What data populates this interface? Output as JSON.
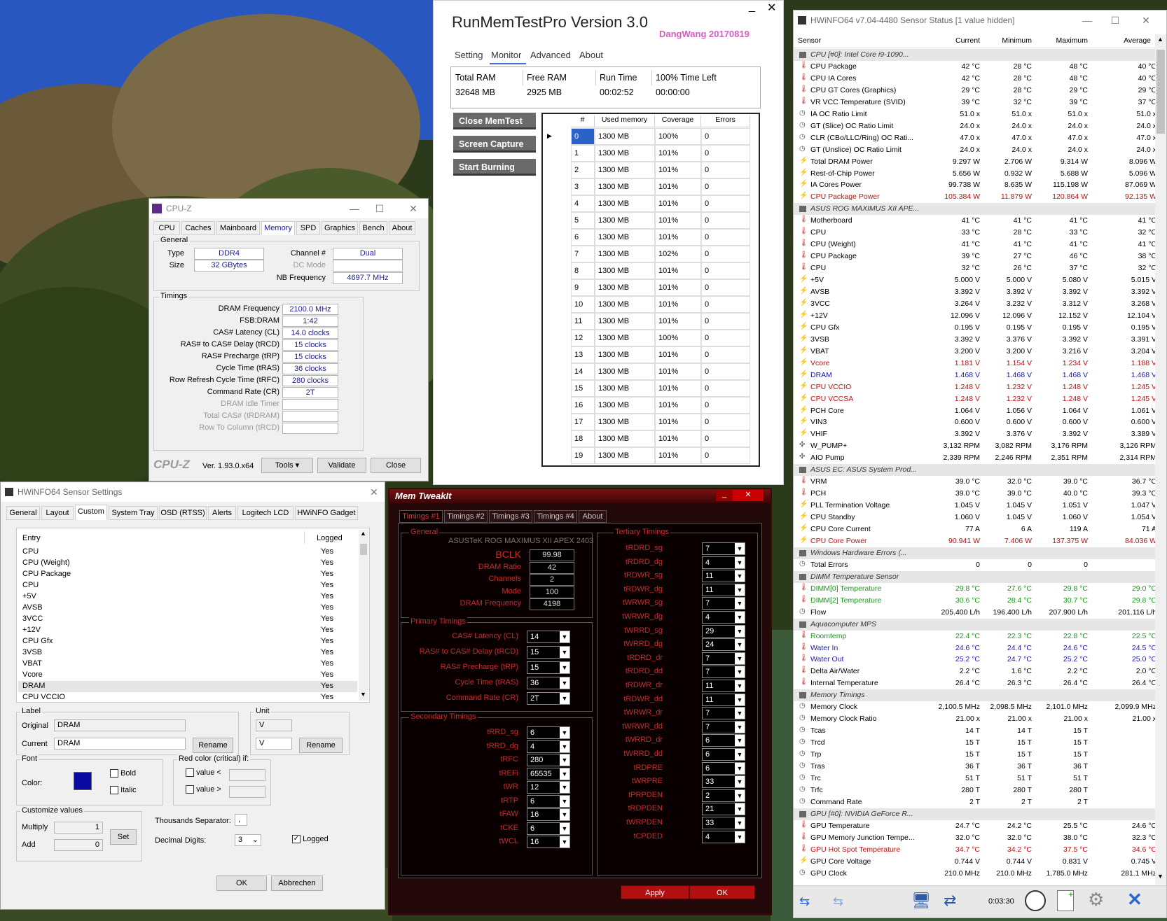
{
  "runmem": {
    "title": "RunMemTestPro Version 3.0",
    "author": "DangWang 20170819",
    "tabs": [
      "Setting",
      "Monitor",
      "Advanced",
      "About"
    ],
    "stats": [
      {
        "label": "Total RAM",
        "value": "32648 MB"
      },
      {
        "label": "Free RAM",
        "value": "2925 MB"
      },
      {
        "label": "Run Time",
        "value": "00:02:52"
      },
      {
        "label": "100% Time Left",
        "value": "00:00:00"
      }
    ],
    "buttons": [
      "Close MemTest",
      "Screen Capture",
      "Start Burning"
    ],
    "headers": [
      "#",
      "Used memory",
      "Coverage",
      "Errors"
    ],
    "rows": [
      [
        "0",
        "1300 MB",
        "100%",
        "0"
      ],
      [
        "1",
        "1300 MB",
        "101%",
        "0"
      ],
      [
        "2",
        "1300 MB",
        "101%",
        "0"
      ],
      [
        "3",
        "1300 MB",
        "101%",
        "0"
      ],
      [
        "4",
        "1300 MB",
        "101%",
        "0"
      ],
      [
        "5",
        "1300 MB",
        "101%",
        "0"
      ],
      [
        "6",
        "1300 MB",
        "101%",
        "0"
      ],
      [
        "7",
        "1300 MB",
        "102%",
        "0"
      ],
      [
        "8",
        "1300 MB",
        "101%",
        "0"
      ],
      [
        "9",
        "1300 MB",
        "101%",
        "0"
      ],
      [
        "10",
        "1300 MB",
        "101%",
        "0"
      ],
      [
        "11",
        "1300 MB",
        "101%",
        "0"
      ],
      [
        "12",
        "1300 MB",
        "100%",
        "0"
      ],
      [
        "13",
        "1300 MB",
        "101%",
        "0"
      ],
      [
        "14",
        "1300 MB",
        "101%",
        "0"
      ],
      [
        "15",
        "1300 MB",
        "101%",
        "0"
      ],
      [
        "16",
        "1300 MB",
        "101%",
        "0"
      ],
      [
        "17",
        "1300 MB",
        "101%",
        "0"
      ],
      [
        "18",
        "1300 MB",
        "101%",
        "0"
      ],
      [
        "19",
        "1300 MB",
        "101%",
        "0"
      ]
    ]
  },
  "cpuz": {
    "title": "CPU-Z",
    "tabs": [
      "CPU",
      "Caches",
      "Mainboard",
      "Memory",
      "SPD",
      "Graphics",
      "Bench",
      "About"
    ],
    "active_tab": "Memory",
    "general_label": "General",
    "type_label": "Type",
    "type": "DDR4",
    "size_label": "Size",
    "size": "32 GBytes",
    "channel_label": "Channel #",
    "channel": "Dual",
    "dcmode_label": "DC Mode",
    "nbfreq_label": "NB Frequency",
    "nbfreq": "4697.7 MHz",
    "timings_label": "Timings",
    "timings": [
      [
        "DRAM Frequency",
        "2100.0 MHz"
      ],
      [
        "FSB:DRAM",
        "1:42"
      ],
      [
        "CAS# Latency (CL)",
        "14.0 clocks"
      ],
      [
        "RAS# to CAS# Delay (tRCD)",
        "15 clocks"
      ],
      [
        "RAS# Precharge (tRP)",
        "15 clocks"
      ],
      [
        "Cycle Time (tRAS)",
        "36 clocks"
      ],
      [
        "Row Refresh Cycle Time (tRFC)",
        "280 clocks"
      ],
      [
        "Command Rate (CR)",
        "2T"
      ]
    ],
    "timings_grey": [
      "DRAM Idle Timer",
      "Total CAS# (tRDRAM)",
      "Row To Column (tRCD)"
    ],
    "brand": "CPU-Z",
    "version": "Ver. 1.93.0.x64",
    "tools": "Tools",
    "validate": "Validate",
    "close": "Close"
  },
  "hwset": {
    "title": "HWiNFO64 Sensor Settings",
    "tabs": [
      "General",
      "Layout",
      "Custom",
      "System Tray",
      "OSD (RTSS)",
      "Alerts",
      "Logitech LCD",
      "HWiNFO Gadget"
    ],
    "active_tab": "Custom",
    "col_entry": "Entry",
    "col_logged": "Logged",
    "entries": [
      "CPU",
      "CPU (Weight)",
      "CPU Package",
      "CPU",
      "+5V",
      "AVSB",
      "3VCC",
      "+12V",
      "CPU Gfx",
      "3VSB",
      "VBAT",
      "Vcore",
      "DRAM",
      "CPU VCCIO"
    ],
    "logged": "Yes",
    "label_grp": "Label",
    "original_label": "Original",
    "original": "DRAM",
    "current_label": "Current",
    "current": "DRAM",
    "rename": "Rename",
    "unit_grp": "Unit",
    "unit1": "V",
    "unit2": "V",
    "font_grp": "Font",
    "color_label": "Color:",
    "bold": "Bold",
    "italic": "Italic",
    "red_grp": "Red color (critical) if:",
    "value_lt": "value <",
    "value_gt": "value >",
    "cust_grp": "Customize values",
    "multiply": "Multiply",
    "multiply_val": "1",
    "add": "Add",
    "add_val": "0",
    "set": "Set",
    "thousands": "Thousands Separator:",
    "thousands_val": ",",
    "decimal": "Decimal Digits:",
    "decimal_val": "3",
    "logged_cb": "Logged",
    "ok": "OK",
    "cancel": "Abbrechen"
  },
  "memtweak": {
    "title": "Mem TweakIt",
    "tabs": [
      "Timings #1",
      "Timings #2",
      "Timings #3",
      "Timings #4",
      "About"
    ],
    "general": "General",
    "board": "ASUSTeK ROG MAXIMUS XII APEX 2403",
    "gen": [
      [
        "BCLK",
        "99.98"
      ],
      [
        "DRAM Ratio",
        "42"
      ],
      [
        "Channels",
        "2"
      ],
      [
        "Mode",
        "100"
      ],
      [
        "DRAM Frequency",
        "4198"
      ]
    ],
    "primary": "Primary Timings",
    "prim": [
      [
        "CAS# Latency (CL)",
        "14"
      ],
      [
        "RAS# to CAS# Delay (tRCD)",
        "15"
      ],
      [
        "RAS# Precharge (tRP)",
        "15"
      ],
      [
        "Cycle Time (tRAS)",
        "36"
      ],
      [
        "Command Rate (CR)",
        "2T"
      ]
    ],
    "secondary": "Secondary Timings",
    "sec": [
      [
        "tRRD_sg",
        "6"
      ],
      [
        "tRRD_dg",
        "4"
      ],
      [
        "tRFC",
        "280"
      ],
      [
        "tREFi",
        "65535"
      ],
      [
        "tWR",
        "12"
      ],
      [
        "tRTP",
        "6"
      ],
      [
        "tFAW",
        "16"
      ],
      [
        "tCKE",
        "6"
      ],
      [
        "tWCL",
        "16"
      ]
    ],
    "tertiary": "Tertiary Timings",
    "ter": [
      [
        "tRDRD_sg",
        "7"
      ],
      [
        "tRDRD_dg",
        "4"
      ],
      [
        "tRDWR_sg",
        "11"
      ],
      [
        "tRDWR_dg",
        "11"
      ],
      [
        "tWRWR_sg",
        "7"
      ],
      [
        "tWRWR_dg",
        "4"
      ],
      [
        "tWRRD_sg",
        "29"
      ],
      [
        "tWRRD_dg",
        "24"
      ],
      [
        "tRDRD_dr",
        "7"
      ],
      [
        "tRDRD_dd",
        "7"
      ],
      [
        "tRDWR_dr",
        "11"
      ],
      [
        "tRDWR_dd",
        "11"
      ],
      [
        "tWRWR_dr",
        "7"
      ],
      [
        "tWRWR_dd",
        "7"
      ],
      [
        "tWRRD_dr",
        "6"
      ],
      [
        "tWRRD_dd",
        "6"
      ],
      [
        "tRDPRE",
        "6"
      ],
      [
        "tWRPRE",
        "33"
      ],
      [
        "tPRPDEN",
        "2"
      ],
      [
        "tRDPDEN",
        "21"
      ],
      [
        "tWRPDEN",
        "33"
      ],
      [
        "tCPDED",
        "4"
      ]
    ],
    "apply": "Apply",
    "ok": "OK"
  },
  "hwinfo": {
    "title": "HWiNFO64 v7.04-4480 Sensor Status [1 value hidden]",
    "headers": [
      "Sensor",
      "Current",
      "Minimum",
      "Maximum",
      "Average"
    ],
    "time": "0:03:30",
    "rows": [
      {
        "g": 1,
        "n": "CPU [#0]: Intel Core i9-1090..."
      },
      {
        "n": "CPU Package",
        "v": [
          "42 °C",
          "28 °C",
          "48 °C",
          "40 °C"
        ],
        "i": "t"
      },
      {
        "n": "CPU IA Cores",
        "v": [
          "42 °C",
          "28 °C",
          "48 °C",
          "40 °C"
        ],
        "i": "t"
      },
      {
        "n": "CPU GT Cores (Graphics)",
        "v": [
          "29 °C",
          "28 °C",
          "29 °C",
          "29 °C"
        ],
        "i": "t"
      },
      {
        "n": "VR VCC Temperature (SVID)",
        "v": [
          "39 °C",
          "32 °C",
          "39 °C",
          "37 °C"
        ],
        "i": "t"
      },
      {
        "n": "IA OC Ratio Limit",
        "v": [
          "51.0 x",
          "51.0 x",
          "51.0 x",
          "51.0 x"
        ],
        "i": "c"
      },
      {
        "n": "GT (Slice) OC Ratio Limit",
        "v": [
          "24.0 x",
          "24.0 x",
          "24.0 x",
          "24.0 x"
        ],
        "i": "c"
      },
      {
        "n": "CLR (CBo/LLC/Ring) OC Rati...",
        "v": [
          "47.0 x",
          "47.0 x",
          "47.0 x",
          "47.0 x"
        ],
        "i": "c"
      },
      {
        "n": "GT (Unslice) OC Ratio Limit",
        "v": [
          "24.0 x",
          "24.0 x",
          "24.0 x",
          "24.0 x"
        ],
        "i": "c"
      },
      {
        "n": "Total DRAM Power",
        "v": [
          "9.297 W",
          "2.706 W",
          "9.314 W",
          "8.096 W"
        ],
        "i": "p"
      },
      {
        "n": "Rest-of-Chip Power",
        "v": [
          "5.656 W",
          "0.932 W",
          "5.688 W",
          "5.096 W"
        ],
        "i": "p"
      },
      {
        "n": "IA Cores Power",
        "v": [
          "99.738 W",
          "8.635 W",
          "115.198 W",
          "87.069 W"
        ],
        "i": "p"
      },
      {
        "n": "CPU Package Power",
        "v": [
          "105.384 W",
          "11.879 W",
          "120.864 W",
          "92.135 W"
        ],
        "i": "p",
        "c": "r"
      },
      {
        "g": 1,
        "n": "ASUS ROG MAXIMUS XII APE..."
      },
      {
        "n": "Motherboard",
        "v": [
          "41 °C",
          "41 °C",
          "41 °C",
          "41 °C"
        ],
        "i": "t"
      },
      {
        "n": "CPU",
        "v": [
          "33 °C",
          "28 °C",
          "33 °C",
          "32 °C"
        ],
        "i": "t"
      },
      {
        "n": "CPU (Weight)",
        "v": [
          "41 °C",
          "41 °C",
          "41 °C",
          "41 °C"
        ],
        "i": "t"
      },
      {
        "n": "CPU Package",
        "v": [
          "39 °C",
          "27 °C",
          "46 °C",
          "38 °C"
        ],
        "i": "t"
      },
      {
        "n": "CPU",
        "v": [
          "32 °C",
          "26 °C",
          "37 °C",
          "32 °C"
        ],
        "i": "t"
      },
      {
        "n": "+5V",
        "v": [
          "5.000 V",
          "5.000 V",
          "5.080 V",
          "5.015 V"
        ],
        "i": "p"
      },
      {
        "n": "AVSB",
        "v": [
          "3.392 V",
          "3.392 V",
          "3.392 V",
          "3.392 V"
        ],
        "i": "p"
      },
      {
        "n": "3VCC",
        "v": [
          "3.264 V",
          "3.232 V",
          "3.312 V",
          "3.268 V"
        ],
        "i": "p"
      },
      {
        "n": "+12V",
        "v": [
          "12.096 V",
          "12.096 V",
          "12.152 V",
          "12.104 V"
        ],
        "i": "p"
      },
      {
        "n": "CPU Gfx",
        "v": [
          "0.195 V",
          "0.195 V",
          "0.195 V",
          "0.195 V"
        ],
        "i": "p"
      },
      {
        "n": "3VSB",
        "v": [
          "3.392 V",
          "3.376 V",
          "3.392 V",
          "3.391 V"
        ],
        "i": "p"
      },
      {
        "n": "VBAT",
        "v": [
          "3.200 V",
          "3.200 V",
          "3.216 V",
          "3.204 V"
        ],
        "i": "p"
      },
      {
        "n": "Vcore",
        "v": [
          "1.181 V",
          "1.154 V",
          "1.234 V",
          "1.188 V"
        ],
        "i": "p",
        "c": "r"
      },
      {
        "n": "DRAM",
        "v": [
          "1.468 V",
          "1.468 V",
          "1.468 V",
          "1.468 V"
        ],
        "i": "p",
        "c": "b"
      },
      {
        "n": "CPU VCCIO",
        "v": [
          "1.248 V",
          "1.232 V",
          "1.248 V",
          "1.245 V"
        ],
        "i": "p",
        "c": "r"
      },
      {
        "n": "CPU VCCSA",
        "v": [
          "1.248 V",
          "1.232 V",
          "1.248 V",
          "1.245 V"
        ],
        "i": "p",
        "c": "r"
      },
      {
        "n": "PCH Core",
        "v": [
          "1.064 V",
          "1.056 V",
          "1.064 V",
          "1.061 V"
        ],
        "i": "p"
      },
      {
        "n": "VIN3",
        "v": [
          "0.600 V",
          "0.600 V",
          "0.600 V",
          "0.600 V"
        ],
        "i": "p"
      },
      {
        "n": "VHIF",
        "v": [
          "3.392 V",
          "3.376 V",
          "3.392 V",
          "3.389 V"
        ],
        "i": "p"
      },
      {
        "n": "W_PUMP+",
        "v": [
          "3,132 RPM",
          "3,082 RPM",
          "3,176 RPM",
          "3,126 RPM"
        ],
        "i": "f"
      },
      {
        "n": "AIO Pump",
        "v": [
          "2,339 RPM",
          "2,246 RPM",
          "2,351 RPM",
          "2,314 RPM"
        ],
        "i": "f"
      },
      {
        "g": 1,
        "n": "ASUS EC: ASUS System Prod..."
      },
      {
        "n": "VRM",
        "v": [
          "39.0 °C",
          "32.0 °C",
          "39.0 °C",
          "36.7 °C"
        ],
        "i": "t"
      },
      {
        "n": "PCH",
        "v": [
          "39.0 °C",
          "39.0 °C",
          "40.0 °C",
          "39.3 °C"
        ],
        "i": "t"
      },
      {
        "n": "PLL Termination Voltage",
        "v": [
          "1.045 V",
          "1.045 V",
          "1.051 V",
          "1.047 V"
        ],
        "i": "p"
      },
      {
        "n": "CPU Standby",
        "v": [
          "1.060 V",
          "1.045 V",
          "1.060 V",
          "1.054 V"
        ],
        "i": "p"
      },
      {
        "n": "CPU Core Current",
        "v": [
          "77 A",
          "6 A",
          "119 A",
          "71 A"
        ],
        "i": "p"
      },
      {
        "n": "CPU Core Power",
        "v": [
          "90.941 W",
          "7.406 W",
          "137.375 W",
          "84.036 W"
        ],
        "i": "p",
        "c": "r"
      },
      {
        "g": 1,
        "n": "Windows Hardware Errors (..."
      },
      {
        "n": "Total Errors",
        "v": [
          "0",
          "0",
          "0",
          ""
        ],
        "i": "c"
      },
      {
        "g": 1,
        "n": "DIMM Temperature Sensor"
      },
      {
        "n": "DIMM[0] Temperature",
        "v": [
          "29.8 °C",
          "27.6 °C",
          "29.8 °C",
          "29.0 °C"
        ],
        "i": "t",
        "c": "g"
      },
      {
        "n": "DIMM[2] Temperature",
        "v": [
          "30.6 °C",
          "28.4 °C",
          "30.7 °C",
          "29.8 °C"
        ],
        "i": "t",
        "c": "g"
      },
      {
        "n": "Flow",
        "v": [
          "205.400 L/h",
          "196.400 L/h",
          "207.900 L/h",
          "201.116 L/h"
        ],
        "i": "c"
      },
      {
        "g": 1,
        "n": "Aquacomputer MPS"
      },
      {
        "n": "Roomtemp",
        "v": [
          "22.4 °C",
          "22.3 °C",
          "22.8 °C",
          "22.5 °C"
        ],
        "i": "t",
        "c": "g"
      },
      {
        "n": "Water In",
        "v": [
          "24.6 °C",
          "24.4 °C",
          "24.6 °C",
          "24.5 °C"
        ],
        "i": "t",
        "c": "b"
      },
      {
        "n": "Water Out",
        "v": [
          "25.2 °C",
          "24.7 °C",
          "25.2 °C",
          "25.0 °C"
        ],
        "i": "t",
        "c": "b"
      },
      {
        "n": "Delta Air/Water",
        "v": [
          "2.2 °C",
          "1.6 °C",
          "2.2 °C",
          "2.0 °C"
        ],
        "i": "t"
      },
      {
        "n": "Internal Temperature",
        "v": [
          "26.4 °C",
          "26.3 °C",
          "26.4 °C",
          "26.4 °C"
        ],
        "i": "t"
      },
      {
        "g": 1,
        "n": "Memory Timings"
      },
      {
        "n": "Memory Clock",
        "v": [
          "2,100.5 MHz",
          "2,098.5 MHz",
          "2,101.0 MHz",
          "2,099.9 MHz"
        ],
        "i": "c"
      },
      {
        "n": "Memory Clock Ratio",
        "v": [
          "21.00 x",
          "21.00 x",
          "21.00 x",
          "21.00 x"
        ],
        "i": "c"
      },
      {
        "n": "Tcas",
        "v": [
          "14 T",
          "14 T",
          "15 T",
          ""
        ],
        "i": "c"
      },
      {
        "n": "Trcd",
        "v": [
          "15 T",
          "15 T",
          "15 T",
          ""
        ],
        "i": "c"
      },
      {
        "n": "Trp",
        "v": [
          "15 T",
          "15 T",
          "15 T",
          ""
        ],
        "i": "c"
      },
      {
        "n": "Tras",
        "v": [
          "36 T",
          "36 T",
          "36 T",
          ""
        ],
        "i": "c"
      },
      {
        "n": "Trc",
        "v": [
          "51 T",
          "51 T",
          "51 T",
          ""
        ],
        "i": "c"
      },
      {
        "n": "Trfc",
        "v": [
          "280 T",
          "280 T",
          "280 T",
          ""
        ],
        "i": "c"
      },
      {
        "n": "Command Rate",
        "v": [
          "2 T",
          "2 T",
          "2 T",
          ""
        ],
        "i": "c"
      },
      {
        "g": 1,
        "n": "GPU [#0]: NVIDIA GeForce R..."
      },
      {
        "n": "GPU Temperature",
        "v": [
          "24.7 °C",
          "24.2 °C",
          "25.5 °C",
          "24.6 °C"
        ],
        "i": "t"
      },
      {
        "n": "GPU Memory Junction Tempe...",
        "v": [
          "32.0 °C",
          "32.0 °C",
          "38.0 °C",
          "32.3 °C"
        ],
        "i": "t"
      },
      {
        "n": "GPU Hot Spot Temperature",
        "v": [
          "34.7 °C",
          "34.2 °C",
          "37.5 °C",
          "34.6 °C"
        ],
        "i": "t",
        "c": "r"
      },
      {
        "n": "GPU Core Voltage",
        "v": [
          "0.744 V",
          "0.744 V",
          "0.831 V",
          "0.745 V"
        ],
        "i": "p"
      },
      {
        "n": "GPU Clock",
        "v": [
          "210.0 MHz",
          "210.0 MHz",
          "1,785.0 MHz",
          "281.1 MHz"
        ],
        "i": "c"
      }
    ]
  }
}
